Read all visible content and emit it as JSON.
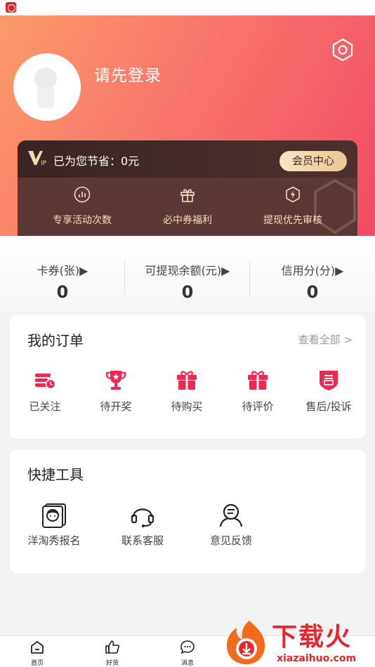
{
  "header": {
    "login_prompt": "请先登录",
    "vip": {
      "savings_text": "已为您节省：0元",
      "member_center": "会员中心",
      "benefits": [
        {
          "label": "专享活动次数",
          "icon": "chart-icon"
        },
        {
          "label": "必中券福利",
          "icon": "gift-icon"
        },
        {
          "label": "提现优先审核",
          "icon": "lightning-icon"
        }
      ]
    }
  },
  "stats": [
    {
      "label": "卡券(张)▶",
      "value": "0"
    },
    {
      "label": "可提现余额(元)▶",
      "value": "0"
    },
    {
      "label": "信用分(分)▶",
      "value": "0"
    }
  ],
  "orders": {
    "title": "我的订单",
    "view_all": "查看全部 >",
    "items": [
      {
        "label": "已关注",
        "icon": "followed-icon"
      },
      {
        "label": "待开奖",
        "icon": "trophy-icon"
      },
      {
        "label": "待购买",
        "icon": "gift-box-icon"
      },
      {
        "label": "待评价",
        "icon": "gift-box-icon"
      },
      {
        "label": "售后/投诉",
        "icon": "after-sales-icon"
      }
    ]
  },
  "tools": {
    "title": "快捷工具",
    "items": [
      {
        "label": "洋淘秀报名",
        "icon": "photo-person-icon"
      },
      {
        "label": "联系客服",
        "icon": "headset-icon"
      },
      {
        "label": "意见反馈",
        "icon": "feedback-icon"
      }
    ]
  },
  "tabbar": [
    {
      "label": "首页",
      "icon": "home-icon"
    },
    {
      "label": "好货",
      "icon": "thumbs-up-icon"
    },
    {
      "label": "消息",
      "icon": "message-icon"
    }
  ],
  "watermark": {
    "text": "下载火",
    "url": "xiazaihuo.com"
  },
  "colors": {
    "accent": "#f0284e",
    "header_start": "#fb9a6a",
    "header_end": "#f24a63",
    "vip_dark": "#4a2c2a",
    "vip_gold": "#e9c893"
  }
}
